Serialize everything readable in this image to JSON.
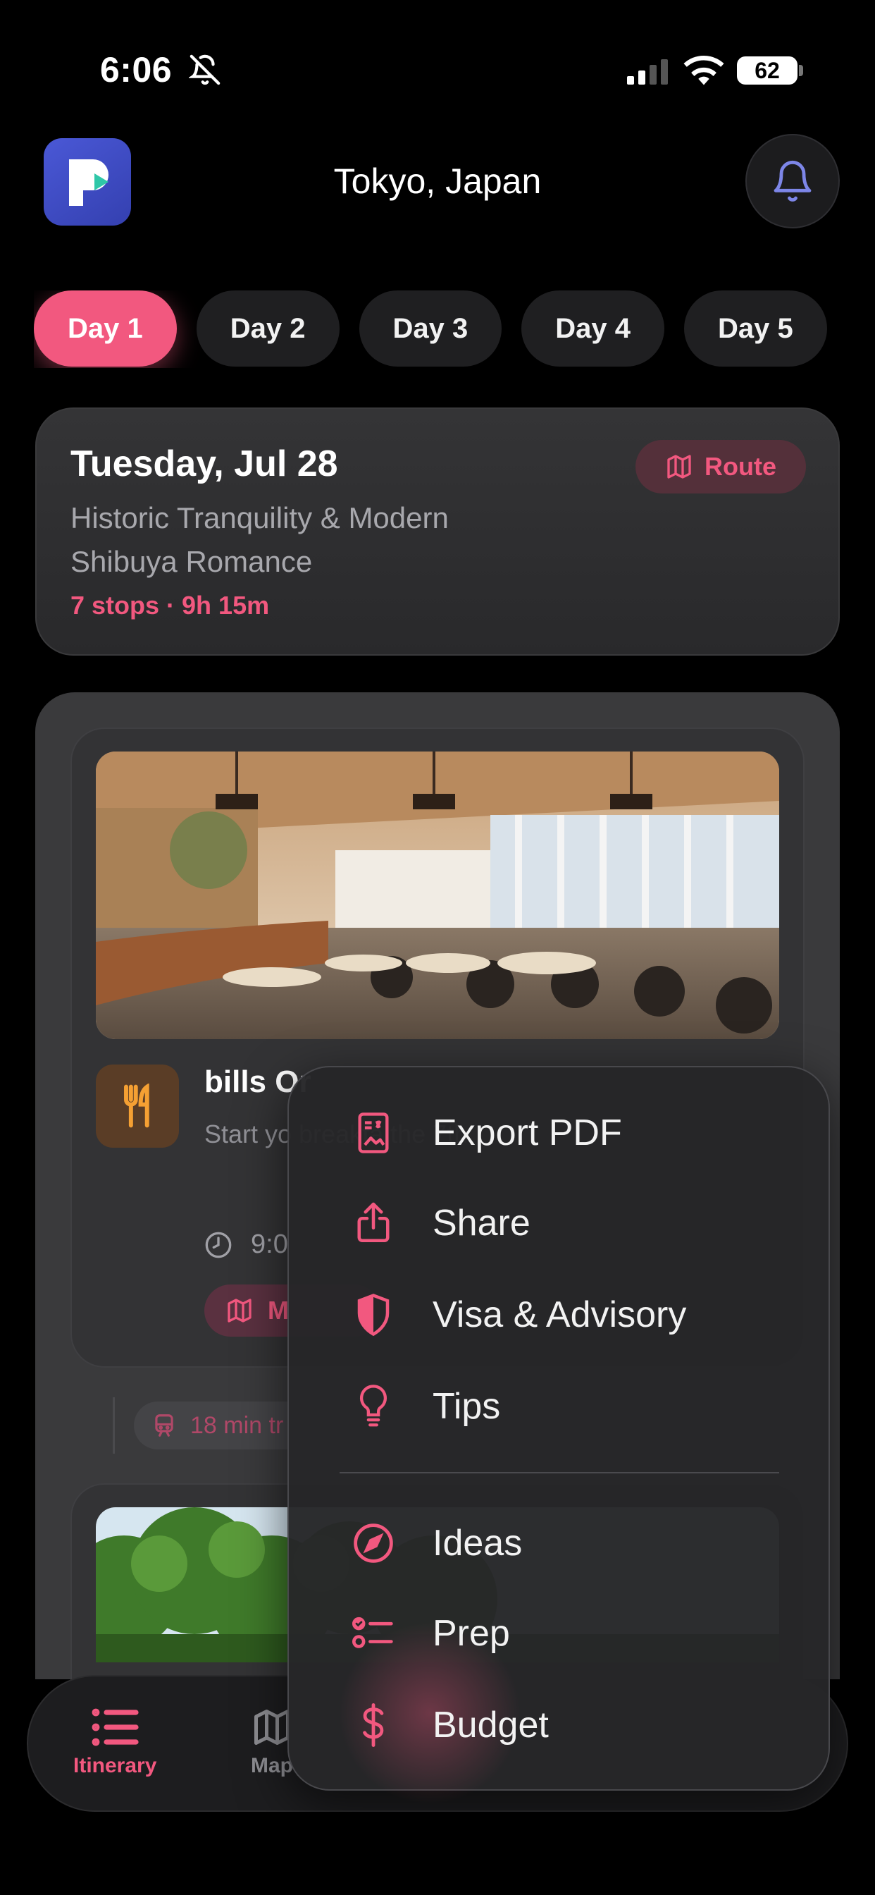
{
  "status_bar": {
    "time": "6:06",
    "battery": "62"
  },
  "header": {
    "title": "Tokyo, Japan"
  },
  "day_tabs": [
    "Day 1",
    "Day 2",
    "Day 3",
    "Day 4",
    "Day 5"
  ],
  "day_card": {
    "date": "Tuesday, Jul 28",
    "theme": "Historic Tranquility & Modern Shibuya Romance",
    "stats": "7 stops · 9h 15m",
    "route_label": "Route"
  },
  "stop": {
    "name": "bills Or",
    "description": "Start yo breakfa the 7th",
    "time": "9:0",
    "map_label": "M"
  },
  "transit": {
    "label": "18 min tr"
  },
  "tab_bar": {
    "itinerary": "Itinerary",
    "map": "Map"
  },
  "menu": {
    "items": [
      {
        "label": "Export PDF",
        "icon": "export-pdf-icon"
      },
      {
        "label": "Share",
        "icon": "share-icon"
      },
      {
        "label": "Visa & Advisory",
        "icon": "shield-icon"
      },
      {
        "label": "Tips",
        "icon": "lightbulb-icon"
      },
      {
        "label": "Ideas",
        "icon": "compass-icon"
      },
      {
        "label": "Prep",
        "icon": "checklist-icon"
      },
      {
        "label": "Budget",
        "icon": "dollar-icon"
      }
    ]
  },
  "colors": {
    "accent": "#f2587f",
    "background": "#000000",
    "logo": "#3f4cc6"
  }
}
